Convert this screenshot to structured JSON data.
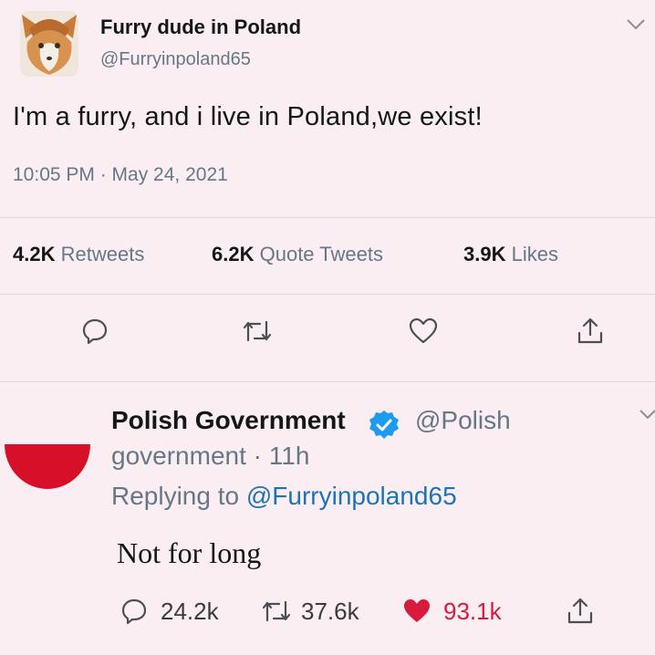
{
  "tweet": {
    "display_name": "Furry dude in Poland",
    "handle": "@Furryinpoland65",
    "text": "I'm a furry, and i live in Poland,we exist!",
    "timestamp": "10:05 PM · May 24, 2021",
    "stats": {
      "retweets_count": "4.2K",
      "retweets_label": "Retweets",
      "quotes_count": "6.2K",
      "quotes_label": "Quote Tweets",
      "likes_count": "3.9K",
      "likes_label": "Likes"
    },
    "actions": [
      "reply-icon",
      "retweet-icon",
      "like-icon",
      "share-icon"
    ]
  },
  "reply": {
    "display_name": "Polish Government",
    "handle_part1": "@Polish",
    "handle_part2": "government",
    "age": "· 11h",
    "replying_prefix": "Replying to",
    "replying_to": "@Furryinpoland65",
    "text": "Not for long",
    "counts": {
      "replies": "24.2k",
      "retweets": "37.6k",
      "likes": "93.1k"
    }
  },
  "colors": {
    "background": "#fbeef3",
    "muted_text": "#657786",
    "link": "#1b74b5",
    "verified": "#1d9bf0",
    "like_red": "#e0245e",
    "poland_red": "#d7102a"
  }
}
